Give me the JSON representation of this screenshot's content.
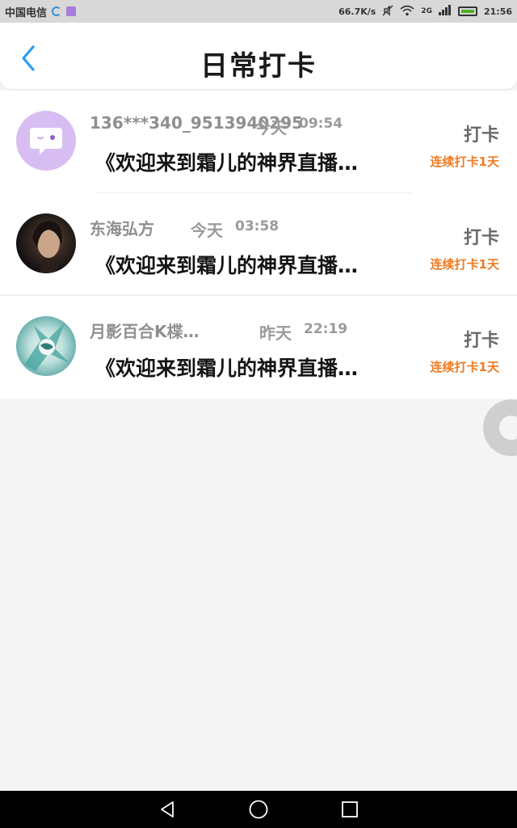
{
  "status_bar": {
    "carrier": "中国电信",
    "net_speed": "66.7K/s",
    "signal_type": "2G",
    "time": "21:56",
    "icons": [
      "sync-icon",
      "app-notification-icon",
      "mute-icon",
      "wifi-icon",
      "signal-icon",
      "battery-icon"
    ]
  },
  "header": {
    "title": "日常打卡",
    "back_icon": "chevron-left-icon",
    "accent_color": "#2a9df4"
  },
  "checkins": [
    {
      "username": "136***340_9513940295",
      "day": "今天",
      "time": "09:54",
      "content": "《欢迎来到霜儿的神界直播…",
      "action": "打卡",
      "streak": "连续打卡1天",
      "avatar": "chat-bubble-avatar"
    },
    {
      "username": "东海弘方",
      "day": "今天",
      "time": "03:58",
      "content": "《欢迎来到霜儿的神界直播…",
      "action": "打卡",
      "streak": "连续打卡1天",
      "avatar": "photo-avatar"
    },
    {
      "username": "月影百合K楪…",
      "day": "昨天",
      "time": "22:19",
      "content": "《欢迎来到霜儿的神界直播…",
      "action": "打卡",
      "streak": "连续打卡1天",
      "avatar": "art-avatar"
    }
  ],
  "colors": {
    "streak": "#f07a20",
    "background": "#f4f4f4"
  }
}
